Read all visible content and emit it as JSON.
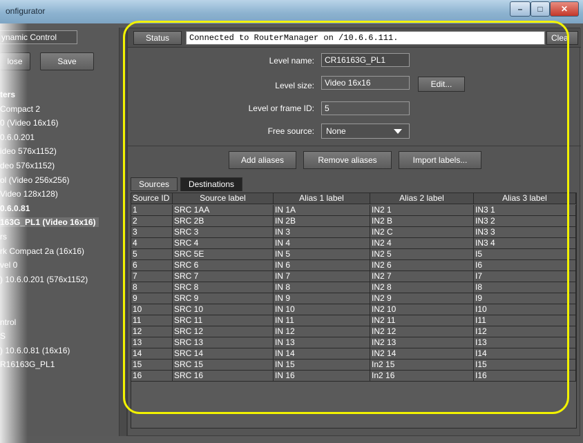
{
  "window": {
    "title": "onfigurator",
    "minimize": "–",
    "maximize": "□",
    "close": "✕"
  },
  "left": {
    "tab": "ynamic Control",
    "close_button": "lose",
    "save_button": "Save",
    "tree": [
      {
        "text": "ters",
        "style": "bold"
      },
      {
        "text": "Compact 2",
        "style": ""
      },
      {
        "text": "0 (Video 16x16)",
        "style": ""
      },
      {
        "text": "0.6.0.201",
        "style": ""
      },
      {
        "text": "ideo 576x1152)",
        "style": ""
      },
      {
        "text": "deo 576x1152)",
        "style": ""
      },
      {
        "text": "ol (Video 256x256)",
        "style": ""
      },
      {
        "text": "Video 128x128)",
        "style": ""
      },
      {
        "text": "0.6.0.81",
        "style": "bold"
      },
      {
        "text": "163G_PL1 (Video 16x16)",
        "style": "sel"
      },
      {
        "text": "rs",
        "style": ""
      },
      {
        "text": "rk Compact 2a (16x16)",
        "style": ""
      },
      {
        "text": "vel 0",
        "style": ""
      },
      {
        "text": ") 10.6.0.201 (576x1152)",
        "style": ""
      },
      {
        "text": "",
        "style": ""
      },
      {
        "text": "",
        "style": ""
      },
      {
        "text": "ntrol",
        "style": ""
      },
      {
        "text": "S",
        "style": ""
      },
      {
        "text": ") 10.6.0.81 (16x16)",
        "style": ""
      },
      {
        "text": "R16163G_PL1",
        "style": ""
      }
    ]
  },
  "status": {
    "button": "Status",
    "message": "Connected to RouterManager on /10.6.6.111.",
    "clear": "Clea"
  },
  "level": {
    "name_label": "Level name:",
    "name_value": "CR16163G_PL1",
    "size_label": "Level size:",
    "size_value": "Video 16x16",
    "edit_button": "Edit...",
    "id_label": "Level or frame ID:",
    "id_value": "5",
    "free_label": "Free source:",
    "free_value": "None"
  },
  "actions": {
    "add": "Add aliases",
    "remove": "Remove aliases",
    "import": "Import labels..."
  },
  "tabs": {
    "sources": "Sources",
    "destinations": "Destinations"
  },
  "table": {
    "headers": [
      "Source ID",
      "Source label",
      "Alias 1 label",
      "Alias 2 label",
      "Alias 3 label"
    ],
    "rows": [
      [
        "1",
        "SRC  1AA",
        "IN 1A",
        "IN2 1",
        "IN3 1"
      ],
      [
        "2",
        "SRC  2B",
        "IN 2B",
        "IN2 B",
        "IN3 2"
      ],
      [
        "3",
        "SRC  3",
        "IN 3",
        "IN2 C",
        "IN3 3"
      ],
      [
        "4",
        "SRC  4",
        "IN 4",
        "IN2 4",
        "IN3 4"
      ],
      [
        "5",
        "SRC  5E",
        "IN 5",
        "IN2 5",
        "I5"
      ],
      [
        "6",
        "SRC  6",
        "IN 6",
        "IN2 6",
        "I6"
      ],
      [
        "7",
        "SRC  7",
        "IN 7",
        "IN2 7",
        "I7"
      ],
      [
        "8",
        "SRC  8",
        "IN 8",
        "IN2 8",
        "I8"
      ],
      [
        "9",
        "SRC  9",
        "IN 9",
        "IN2 9",
        "I9"
      ],
      [
        "10",
        "SRC 10",
        "IN 10",
        "IN2 10",
        "I10"
      ],
      [
        "11",
        "SRC 11",
        "IN 11",
        "IN2 11",
        "I11"
      ],
      [
        "12",
        "SRC 12",
        "IN 12",
        "IN2 12",
        "I12"
      ],
      [
        "13",
        "SRC 13",
        "IN 13",
        "IN2 13",
        "I13"
      ],
      [
        "14",
        "SRC 14",
        "IN 14",
        "IN2 14",
        "I14"
      ],
      [
        "15",
        "SRC 15",
        "IN 15",
        "In2 15",
        "I15"
      ],
      [
        "16",
        "SRC 16",
        "IN 16",
        "In2 16",
        "I16"
      ]
    ]
  }
}
